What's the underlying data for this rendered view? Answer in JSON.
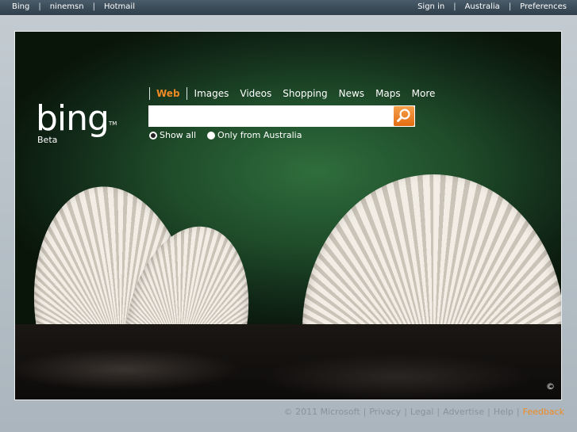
{
  "topbar": {
    "left_links": [
      "Bing",
      "ninemsn",
      "Hotmail"
    ],
    "right_links": [
      "Sign in",
      "Australia",
      "Preferences"
    ]
  },
  "logo": {
    "text": "bing",
    "tm": "TM",
    "beta": "Beta"
  },
  "nav": {
    "items": [
      "Web",
      "Images",
      "Videos",
      "Shopping",
      "News",
      "Maps",
      "More"
    ],
    "active": "Web",
    "active_color": "#f08a24"
  },
  "search": {
    "value": "",
    "button_icon": "search-icon"
  },
  "radios": [
    {
      "label": "Show all",
      "checked": true
    },
    {
      "label": "Only from Australia",
      "checked": false
    }
  ],
  "image_credit": "©",
  "footer": {
    "copyright": "© 2011 Microsoft",
    "links": [
      "Privacy",
      "Legal",
      "Advertise",
      "Help"
    ],
    "feedback": "Feedback"
  }
}
